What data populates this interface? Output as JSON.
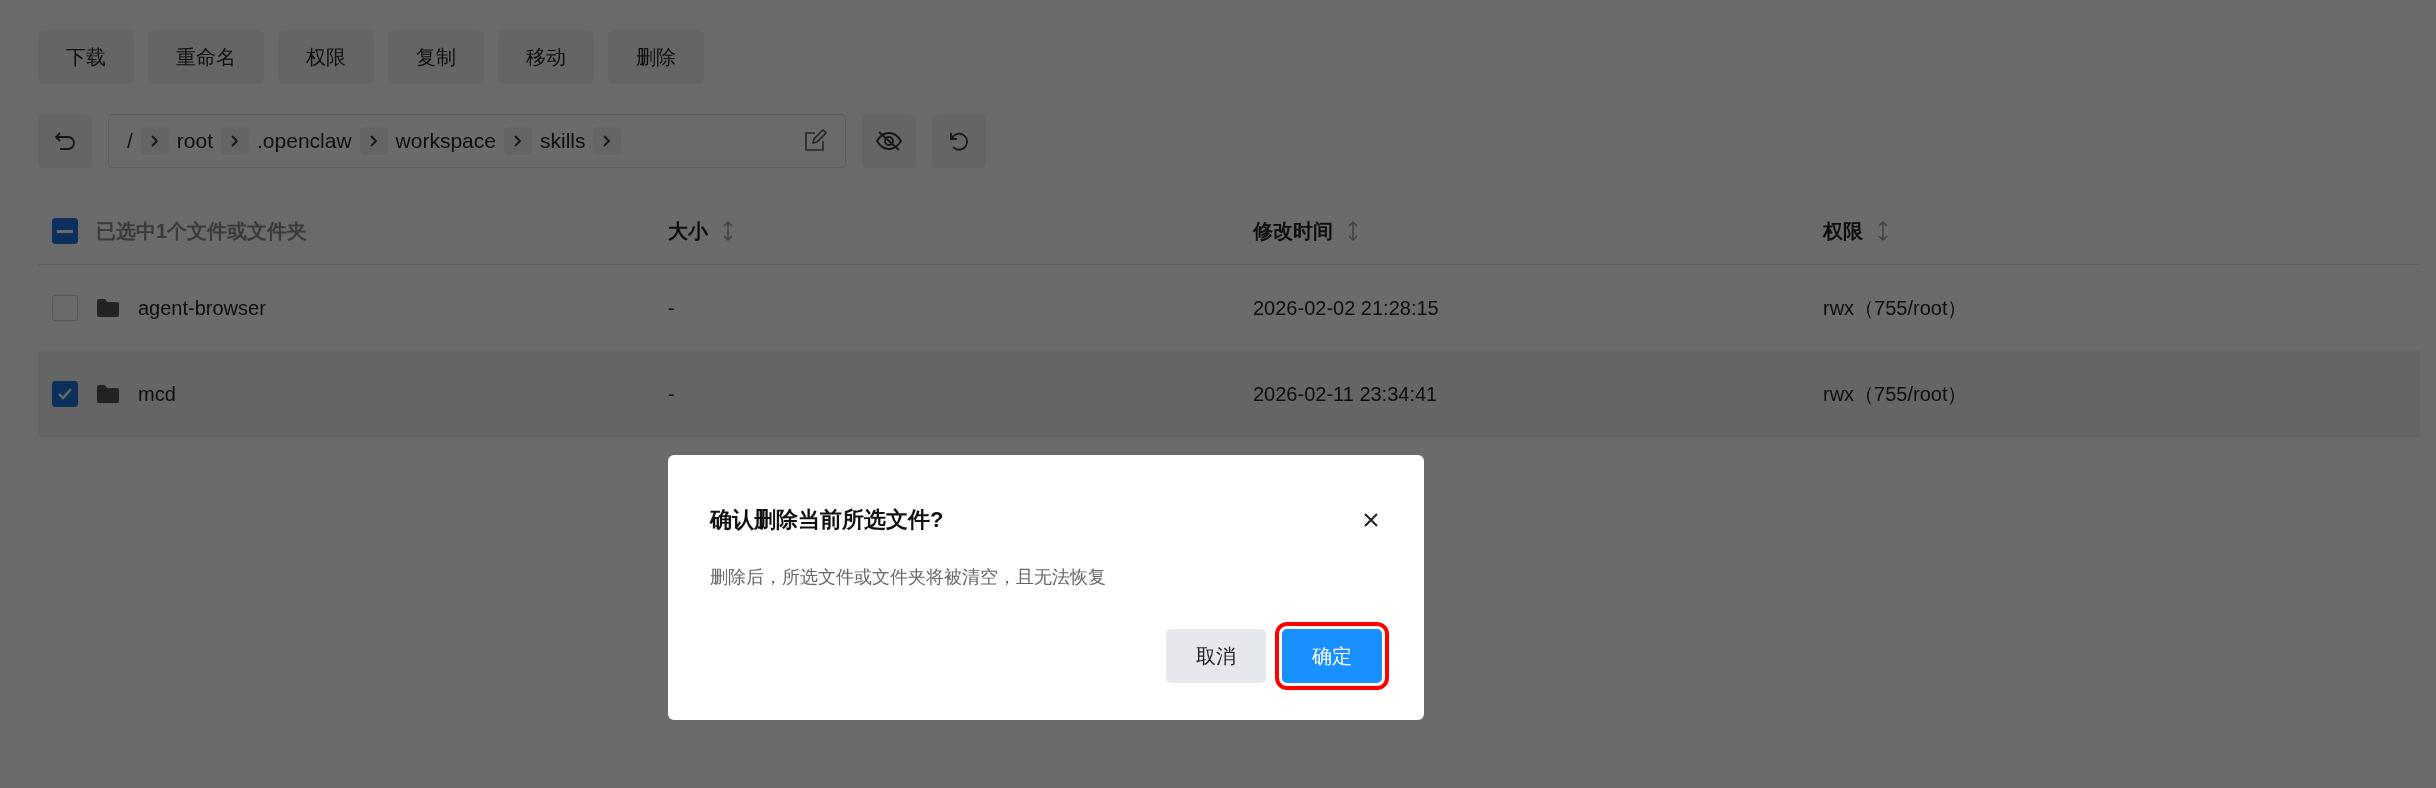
{
  "toolbar": {
    "buttons": [
      "下载",
      "重命名",
      "权限",
      "复制",
      "移动",
      "删除"
    ]
  },
  "path_bar": {
    "root": "/",
    "segments": [
      "root",
      ".openclaw",
      "workspace",
      "skills"
    ]
  },
  "table": {
    "header": {
      "indeterminate": true,
      "label": "已选中1个文件或文件夹"
    },
    "columns": [
      "大小",
      "修改时间",
      "权限"
    ],
    "rows": [
      {
        "name": "agent-browser",
        "checked": false,
        "size": "-",
        "modified": "2026-02-02 21:28:15",
        "permission": "rwx（755/root）"
      },
      {
        "name": "mcd",
        "checked": true,
        "size": "-",
        "modified": "2026-02-11 23:34:41",
        "permission": "rwx（755/root）"
      }
    ]
  },
  "dialog": {
    "title": "确认删除当前所选文件?",
    "message": "删除后，所选文件或文件夹将被清空，且无法恢复",
    "buttons": [
      {
        "label": "取消",
        "kind": "secondary",
        "highlighted": false
      },
      {
        "label": "确定",
        "kind": "primary",
        "highlighted": true
      }
    ]
  }
}
